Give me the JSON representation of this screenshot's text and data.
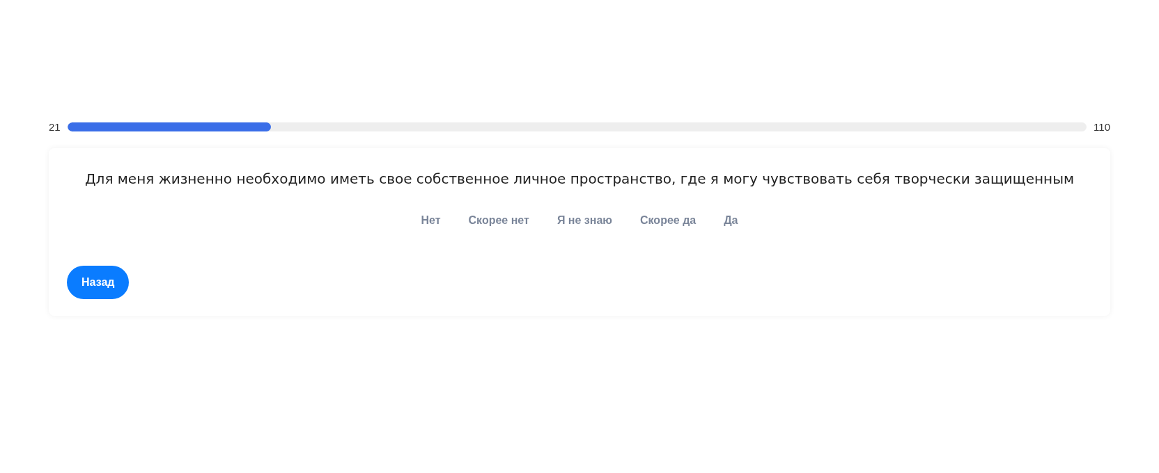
{
  "progress": {
    "current": "21",
    "total": "110",
    "level": 0.2
  },
  "question": {
    "text": "Для меня жизненно необходимо иметь свое собственное личное пространство, где я могу чувствовать себя творчески защищенным"
  },
  "answers": [
    "Нет",
    "Скорее нет",
    "Я не знаю",
    "Скорее да",
    "Да"
  ],
  "back_button": {
    "label": "Назад"
  }
}
